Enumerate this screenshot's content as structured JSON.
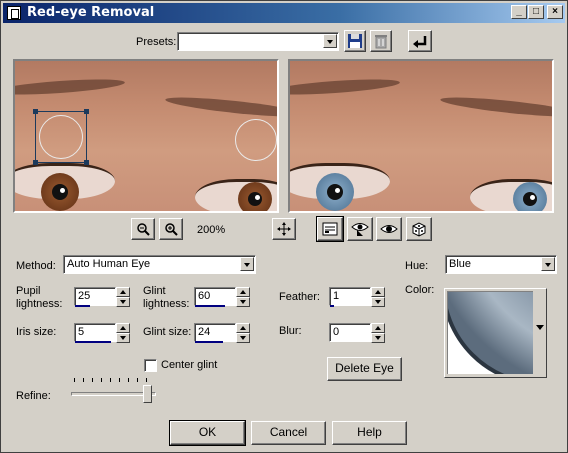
{
  "window": {
    "title": "Red-eye Removal",
    "minimize_glyph": "_",
    "maximize_glyph": "□",
    "close_glyph": "×"
  },
  "presets": {
    "label": "Presets:",
    "value": ""
  },
  "zoom": {
    "level": "200%",
    "zoom_out_icon": "zoom-out-icon",
    "zoom_in_icon": "zoom-in-icon",
    "pan_icon": "move-icon"
  },
  "method": {
    "label": "Method:",
    "value": "Auto Human Eye"
  },
  "pupil_lightness": {
    "label_line1": "Pupil",
    "label_line2": "lightness:",
    "value": "25"
  },
  "glint_lightness": {
    "label_line1": "Glint",
    "label_line2": "lightness:",
    "value": "60"
  },
  "iris_size": {
    "label": "Iris size:",
    "value": "5"
  },
  "glint_size": {
    "label": "Glint size:",
    "value": "24"
  },
  "feather": {
    "label": "Feather:",
    "value": "1"
  },
  "blur": {
    "label": "Blur:",
    "value": "0"
  },
  "center_glint": {
    "label": "Center glint",
    "checked": false
  },
  "delete_eye": {
    "label": "Delete Eye"
  },
  "refine": {
    "label": "Refine:",
    "level_fraction": 0.95
  },
  "hue": {
    "label": "Hue:",
    "value": "Blue"
  },
  "color": {
    "label": "Color:",
    "swatch_color": "#7d8ea0"
  },
  "buttons": {
    "ok": "OK",
    "cancel": "Cancel",
    "help": "Help"
  },
  "colors": {
    "title_bar_start": "#0a246a",
    "title_bar_end": "#a6caf0",
    "dialog_bg": "#d4d0c8",
    "iris_brown": "#7a4424",
    "iris_blue": "#5b86a8"
  }
}
